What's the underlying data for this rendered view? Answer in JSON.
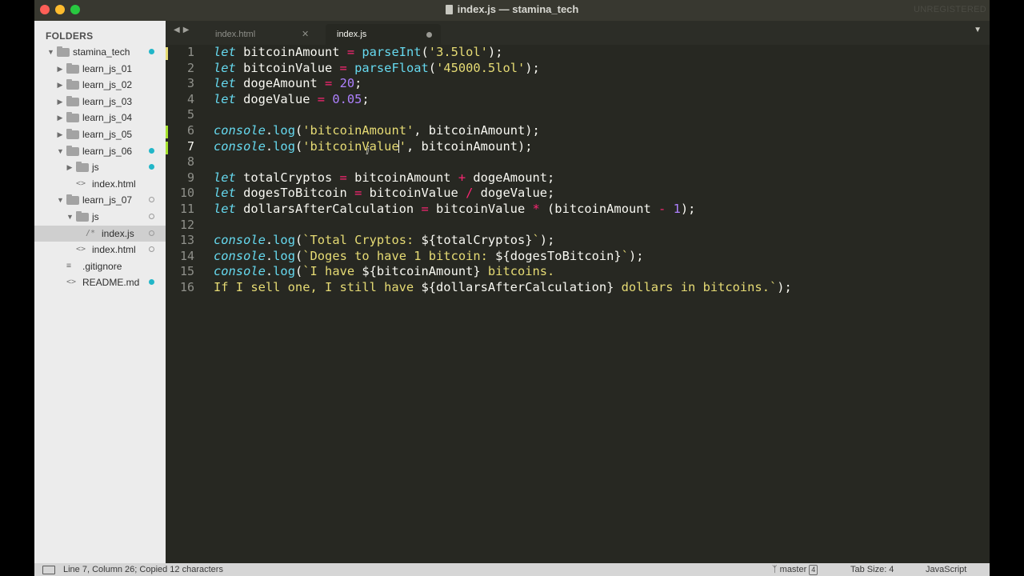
{
  "window": {
    "title": "index.js — stamina_tech",
    "unregistered": "UNREGISTERED"
  },
  "sidebar": {
    "title": "FOLDERS",
    "items": [
      {
        "label": "stamina_tech",
        "type": "folder",
        "depth": 0,
        "expanded": true,
        "status": "modified"
      },
      {
        "label": "learn_js_01",
        "type": "folder",
        "depth": 1,
        "expanded": false,
        "status": ""
      },
      {
        "label": "learn_js_02",
        "type": "folder",
        "depth": 1,
        "expanded": false,
        "status": ""
      },
      {
        "label": "learn_js_03",
        "type": "folder",
        "depth": 1,
        "expanded": false,
        "status": ""
      },
      {
        "label": "learn_js_04",
        "type": "folder",
        "depth": 1,
        "expanded": false,
        "status": ""
      },
      {
        "label": "learn_js_05",
        "type": "folder",
        "depth": 1,
        "expanded": false,
        "status": ""
      },
      {
        "label": "learn_js_06",
        "type": "folder",
        "depth": 1,
        "expanded": true,
        "status": "modified"
      },
      {
        "label": "js",
        "type": "folder",
        "depth": 2,
        "expanded": false,
        "status": "modified"
      },
      {
        "label": "index.html",
        "type": "html",
        "depth": 2,
        "status": ""
      },
      {
        "label": "learn_js_07",
        "type": "folder",
        "depth": 1,
        "expanded": true,
        "status": "untracked"
      },
      {
        "label": "js",
        "type": "folder",
        "depth": 2,
        "expanded": true,
        "status": "untracked"
      },
      {
        "label": "index.js",
        "type": "js",
        "depth": 3,
        "status": "untracked",
        "selected": true
      },
      {
        "label": "index.html",
        "type": "html",
        "depth": 2,
        "status": "untracked"
      },
      {
        "label": ".gitignore",
        "type": "text",
        "depth": 1,
        "status": ""
      },
      {
        "label": "README.md",
        "type": "html",
        "depth": 1,
        "status": "modified"
      }
    ]
  },
  "tabs": [
    {
      "label": "index.html",
      "active": false
    },
    {
      "label": "index.js",
      "active": true,
      "dirty": true
    }
  ],
  "editor": {
    "active_line": 7,
    "lines": [
      "1",
      "2",
      "3",
      "4",
      "5",
      "6",
      "7",
      "8",
      "9",
      "10",
      "11",
      "12",
      "13",
      "14",
      "15",
      "16"
    ]
  },
  "statusbar": {
    "position": "Line 7, Column 26; Copied 12 characters",
    "branch": "master",
    "branch_count": "4",
    "tab_size": "Tab Size: 4",
    "syntax": "JavaScript"
  },
  "colors": {
    "background": "#272822",
    "keyword": "#66d9ef",
    "operator": "#f92672",
    "string": "#e6db74",
    "number": "#ae81ff",
    "git_modified": "#21b6c8"
  }
}
